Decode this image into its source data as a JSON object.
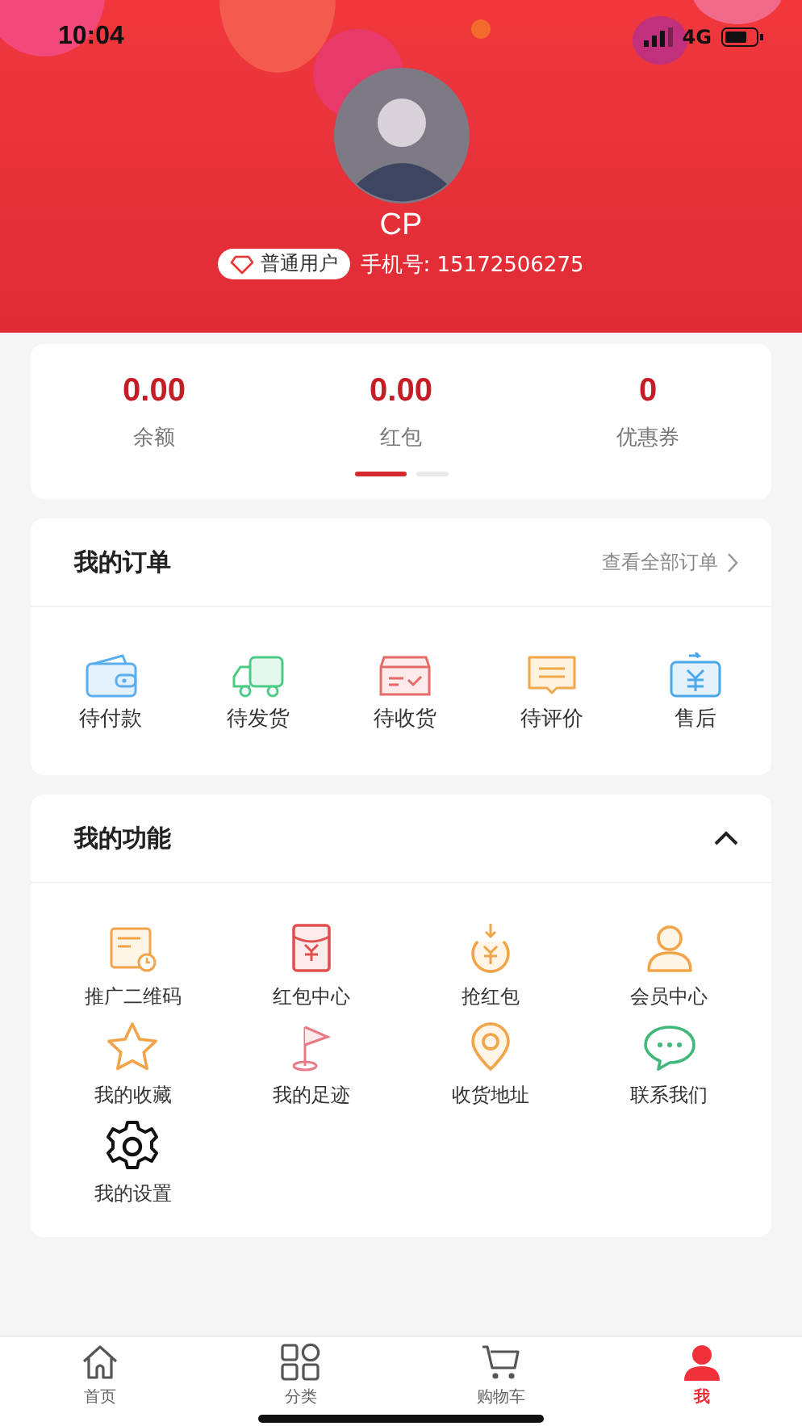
{
  "status_bar": {
    "time": "10:04",
    "network": "4G"
  },
  "profile": {
    "name": "CP",
    "badge": "普通用户",
    "phone": "手机号: 15172506275"
  },
  "wallet": {
    "items": [
      {
        "value": "0.00",
        "label": "余额"
      },
      {
        "value": "0.00",
        "label": "红包"
      },
      {
        "value": "0",
        "label": "优惠券"
      }
    ],
    "pager": [
      {
        "selected": true
      },
      {
        "selected": false
      }
    ]
  },
  "orders": {
    "title": "我的订单",
    "link": "查看全部订单",
    "items": [
      {
        "label": "待付款"
      },
      {
        "label": "待发货"
      },
      {
        "label": "待收货"
      },
      {
        "label": "待评价"
      },
      {
        "label": "售后"
      }
    ]
  },
  "functions": {
    "title": "我的功能",
    "expanded": true,
    "items": [
      {
        "label": "推广二维码"
      },
      {
        "label": "红包中心"
      },
      {
        "label": "抢红包"
      },
      {
        "label": "会员中心"
      },
      {
        "label": "我的收藏"
      },
      {
        "label": "我的足迹"
      },
      {
        "label": "收货地址"
      },
      {
        "label": "联系我们"
      },
      {
        "label": "我的设置"
      }
    ]
  },
  "tab_bar": [
    {
      "label": "首页",
      "selected": false
    },
    {
      "label": "分类",
      "selected": false
    },
    {
      "label": "购物车",
      "selected": false
    },
    {
      "label": "我",
      "selected": true
    }
  ]
}
